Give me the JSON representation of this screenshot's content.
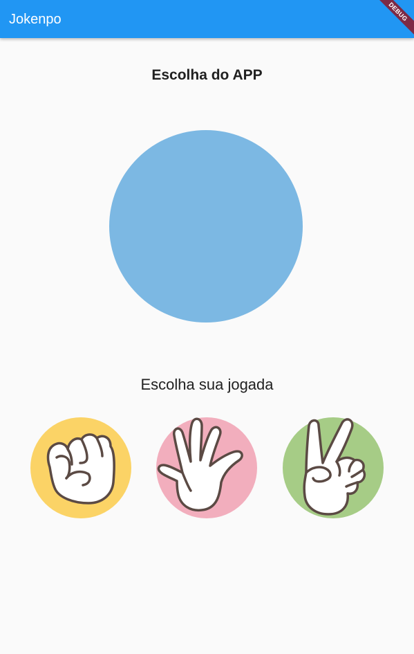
{
  "appbar": {
    "title": "Jokenpo",
    "debug_label": "DEBUG"
  },
  "app_choice": {
    "title": "Escolha do APP",
    "color": "#7cb8e3"
  },
  "player": {
    "title": "Escolha sua jogada",
    "options": [
      {
        "name": "rock",
        "color": "#fbd366"
      },
      {
        "name": "paper",
        "color": "#f2aebd"
      },
      {
        "name": "scissors",
        "color": "#a6cc86"
      }
    ]
  },
  "colors": {
    "appbar": "#2196f3",
    "outline": "#5b4a44",
    "hand_fill": "#ffffff"
  }
}
